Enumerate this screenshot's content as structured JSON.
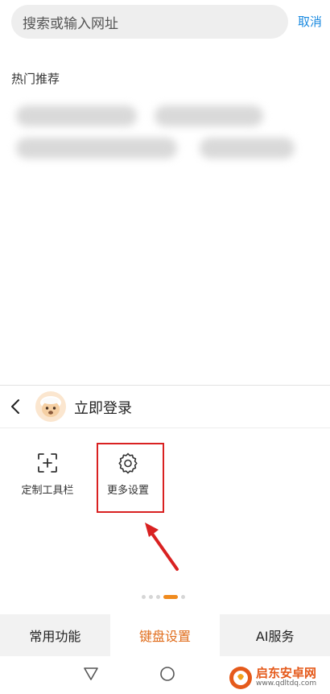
{
  "search": {
    "placeholder": "搜索或输入网址",
    "cancel_label": "取消"
  },
  "hot": {
    "title": "热门推荐"
  },
  "panel": {
    "login_label": "立即登录",
    "tools": [
      {
        "label": "定制工具栏",
        "icon": "add-square-icon"
      },
      {
        "label": "更多设置",
        "icon": "gear-icon"
      }
    ],
    "page_indicator": {
      "total": 5,
      "active": 4
    },
    "tabs": [
      {
        "label": "常用功能"
      },
      {
        "label": "键盘设置"
      },
      {
        "label": "AI服务"
      }
    ],
    "active_tab": 1
  },
  "colors": {
    "accent_orange": "#e06d1c",
    "link_blue": "#1a8ae0",
    "highlight_red": "#d92121"
  },
  "watermark": {
    "title": "启东安卓网",
    "url": "www.qdltdq.com"
  }
}
